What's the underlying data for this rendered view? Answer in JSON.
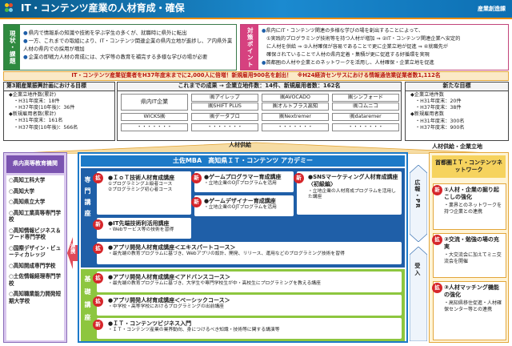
{
  "header": {
    "title": "IT・コンテンツ産業の人材育成・確保",
    "dept": "産業創造課"
  },
  "status": {
    "label": "現状・課題",
    "items": [
      "県内で情報系の知識や技術を学ぶ学生の多くが、就職時に県外に転出",
      "一方、これまでの取組により、IT・コンテンツ関連企業の県内立地が進捗し、ア内県外業人材の県内での採用が増加",
      "企業の即戦力人材の育成には、大学等の教育を補完する多様な学びの場が必要"
    ]
  },
  "policy": {
    "label": "対策ポイント",
    "items": [
      "県内にIT・コンテンツ関連の多様な学びの場を創出することによって、",
      "①実践的プログラミング技術等を持つ人材が増加 ⇒ ②IT・コンテンツ関連企業へ安定的",
      "に人材を供給 ⇒ ③人材確保が容易であることで更に企業立地が促進 ⇒ ④就職先が",
      "確保されていることで人材の県内定着・集積が更に促進する好循環を実現",
      "首都圏の人材や企業とのネットワークを活用し、人材確保・企業立地を促進"
    ]
  },
  "goal_banner": "IT・コンテンツ産業従業者をH37年度末までに2,000人に倍増！新規雇用900名を創出！　※H24経済センサスにおける情報通信業従業者数1,112名",
  "goal_left": {
    "title": "第3期産業振興計画における目標",
    "lines": [
      "◆企業立地件数(累計)",
      "・H31年度末：18件",
      "・H37年度(10年後)：36件",
      "◆新規雇用者数(累計)",
      "・H31年度末：161名",
      "・H37年度(10年後)：566名"
    ]
  },
  "achievements": {
    "title": "これまでの成果 → 企業立地件数：14件、新規雇用者数：162名",
    "rows": [
      [
        "県内IT企業",
        "㈱アイレップ",
        "㈱AVOCADO",
        "㈱シンフォード"
      ],
      [
        "",
        "㈱SHIFT PLUS",
        "㈱オルトプラス高知",
        "㈱コムニコ"
      ],
      [
        "WICKS㈱",
        "㈱データブロ",
        "㈱Nextremer",
        "㈱dataremer"
      ],
      [
        "・・・・・・・",
        "・・・・・・・",
        "・・・・・・・",
        "・・・・・・・"
      ]
    ]
  },
  "goal_right": {
    "title": "新たな目標",
    "lines": [
      "◆企業立地件数",
      "・H31年度末：20件",
      "・H37年度末：38件",
      "◆新規雇用者数",
      "・H31年度末：300名",
      "・H37年度末：900名"
    ]
  },
  "flow_labels": {
    "supply": "人材供給",
    "supply_right": "人材供給・企業立地"
  },
  "schools": {
    "title": "県内高等教育機関",
    "items": [
      "高知工科大学",
      "高知大学",
      "高知県立大学",
      "高知工業高等専門学校",
      "高知情報ビジネス＆フード専門学校",
      "国際デザイン・ビューティカレッジ",
      "高知開成専門学校",
      "土佐情報経理専門学校",
      "高知職業能力開発短期大学校"
    ],
    "link": "連携"
  },
  "academy": {
    "title": "土佐MBA　高知県ＩＴ・コンテンツ アカデミー",
    "senmon": "専門講座",
    "kiso": "基礎講座",
    "courses": [
      {
        "badge": "拡",
        "title": "●ＩｏＴ技術人材育成講座",
        "desc": "①プログラミング上級者コース\n②プログラミング初心者コース"
      },
      {
        "badge": "新",
        "title": "●ゲームプログラマー育成講座",
        "desc": "・立地企業のOJTプログラムを活用"
      },
      {
        "badge": "新",
        "title": "●SNSマーケティング人材育成講座〈初級編〉",
        "desc": "・立地企業の人材育成プログラムを活用した講座"
      },
      {
        "badge": "新",
        "title": "●IT先端技術利活用講座",
        "desc": "・Webサービス等の技術を習得"
      },
      {
        "badge": "新",
        "title": "●ゲームデザイナー育成講座",
        "desc": "・立地企業のOJTプログラムを活用"
      },
      {
        "badge": "拡",
        "title": "●アプリ開発人材育成講座＜エキスパートコース＞",
        "desc": "・最先端の教育プログラムに基づき、Webアプリの設計、開発、リリース、運用などのプログラミング技術を習得"
      },
      {
        "badge": "拡",
        "title": "●アプリ開発人材育成講座＜アドバンスコース＞",
        "desc": "・最先端の教育プログラムに基づき、大学生や専門学校生が中・高校生にプログラミングを教える講座"
      },
      {
        "badge": "拡",
        "title": "●アプリ開発人材育成講座＜ベーシックコース＞",
        "desc": "・中学校・高等学校におけるプログラミングの出前講座"
      },
      {
        "badge": "新",
        "title": "●ＩＴ・コンテンツビジネス入門",
        "desc": "・ＩＴ・コンテンツ産業の業界動向、身につけるべき知識・技術等に関する講演等"
      }
    ]
  },
  "side_labels": {
    "pr": "広報・PR",
    "ukeire": "受入"
  },
  "network": {
    "title": "首都圏ＩＴ・コンテンツネットワーク",
    "items": [
      {
        "title": "①人材・企業の掘り起こしの強化",
        "desc": "・業界とのネットワークを持つ企業との連携"
      },
      {
        "title": "②交流・勉強の場の充実",
        "desc": "・大交流会に加えてミニ交流会を開催"
      },
      {
        "title": "③人材マッチング機能の強化",
        "desc": "・高知県移住促進・人材確保センター等との連携"
      }
    ]
  }
}
